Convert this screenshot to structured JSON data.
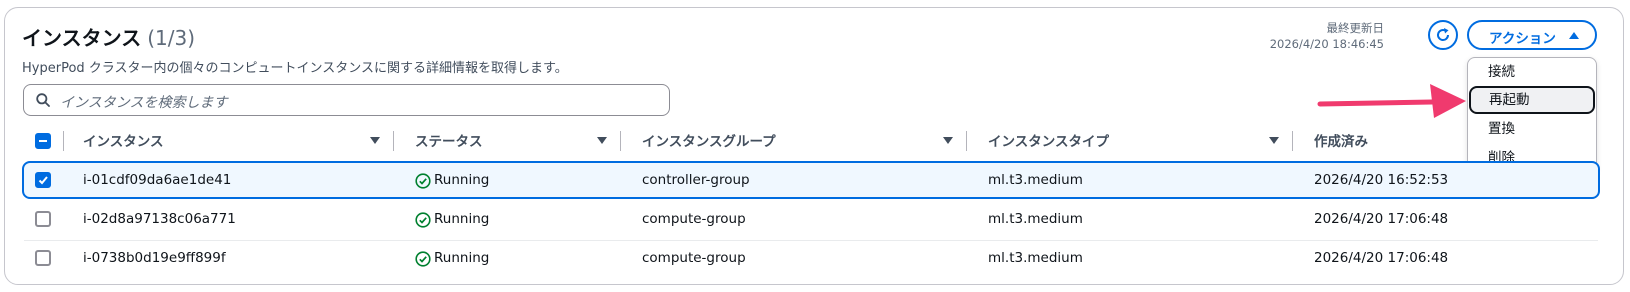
{
  "header": {
    "title": "インスタンス",
    "count": "(1/3)",
    "description": "HyperPod クラスター内の個々のコンピュートインスタンスに関する詳細情報を取得します。",
    "last_updated_label": "最終更新日",
    "last_updated_value": "2026/4/20 18:46:45",
    "actions_label": "アクション"
  },
  "search": {
    "placeholder": "インスタンスを検索します"
  },
  "actions_menu": {
    "items": [
      {
        "label": "接続"
      },
      {
        "label": "再起動"
      },
      {
        "label": "置換"
      },
      {
        "label": "削除"
      }
    ],
    "highlighted": "再起動"
  },
  "table": {
    "columns": [
      "インスタンス",
      "ステータス",
      "インスタンスグループ",
      "インスタンスタイプ",
      "作成済み"
    ],
    "rows": [
      {
        "selected": true,
        "instance": "i-01cdf09da6ae1de41",
        "status": "Running",
        "group": "controller-group",
        "type": "ml.t3.medium",
        "created": "2026/4/20 16:52:53"
      },
      {
        "selected": false,
        "instance": "i-02d8a97138c06a771",
        "status": "Running",
        "group": "compute-group",
        "type": "ml.t3.medium",
        "created": "2026/4/20 17:06:48"
      },
      {
        "selected": false,
        "instance": "i-0738b0d19e9ff899f",
        "status": "Running",
        "group": "compute-group",
        "type": "ml.t3.medium",
        "created": "2026/4/20 17:06:48"
      }
    ]
  },
  "colors": {
    "accent": "#006ce0",
    "success": "#00802f",
    "annotation_arrow": "#f03a6e"
  },
  "icons": {
    "search": "search-icon",
    "refresh": "refresh-icon",
    "status_ok": "check-circle-icon",
    "sort": "sort-caret-icon"
  }
}
